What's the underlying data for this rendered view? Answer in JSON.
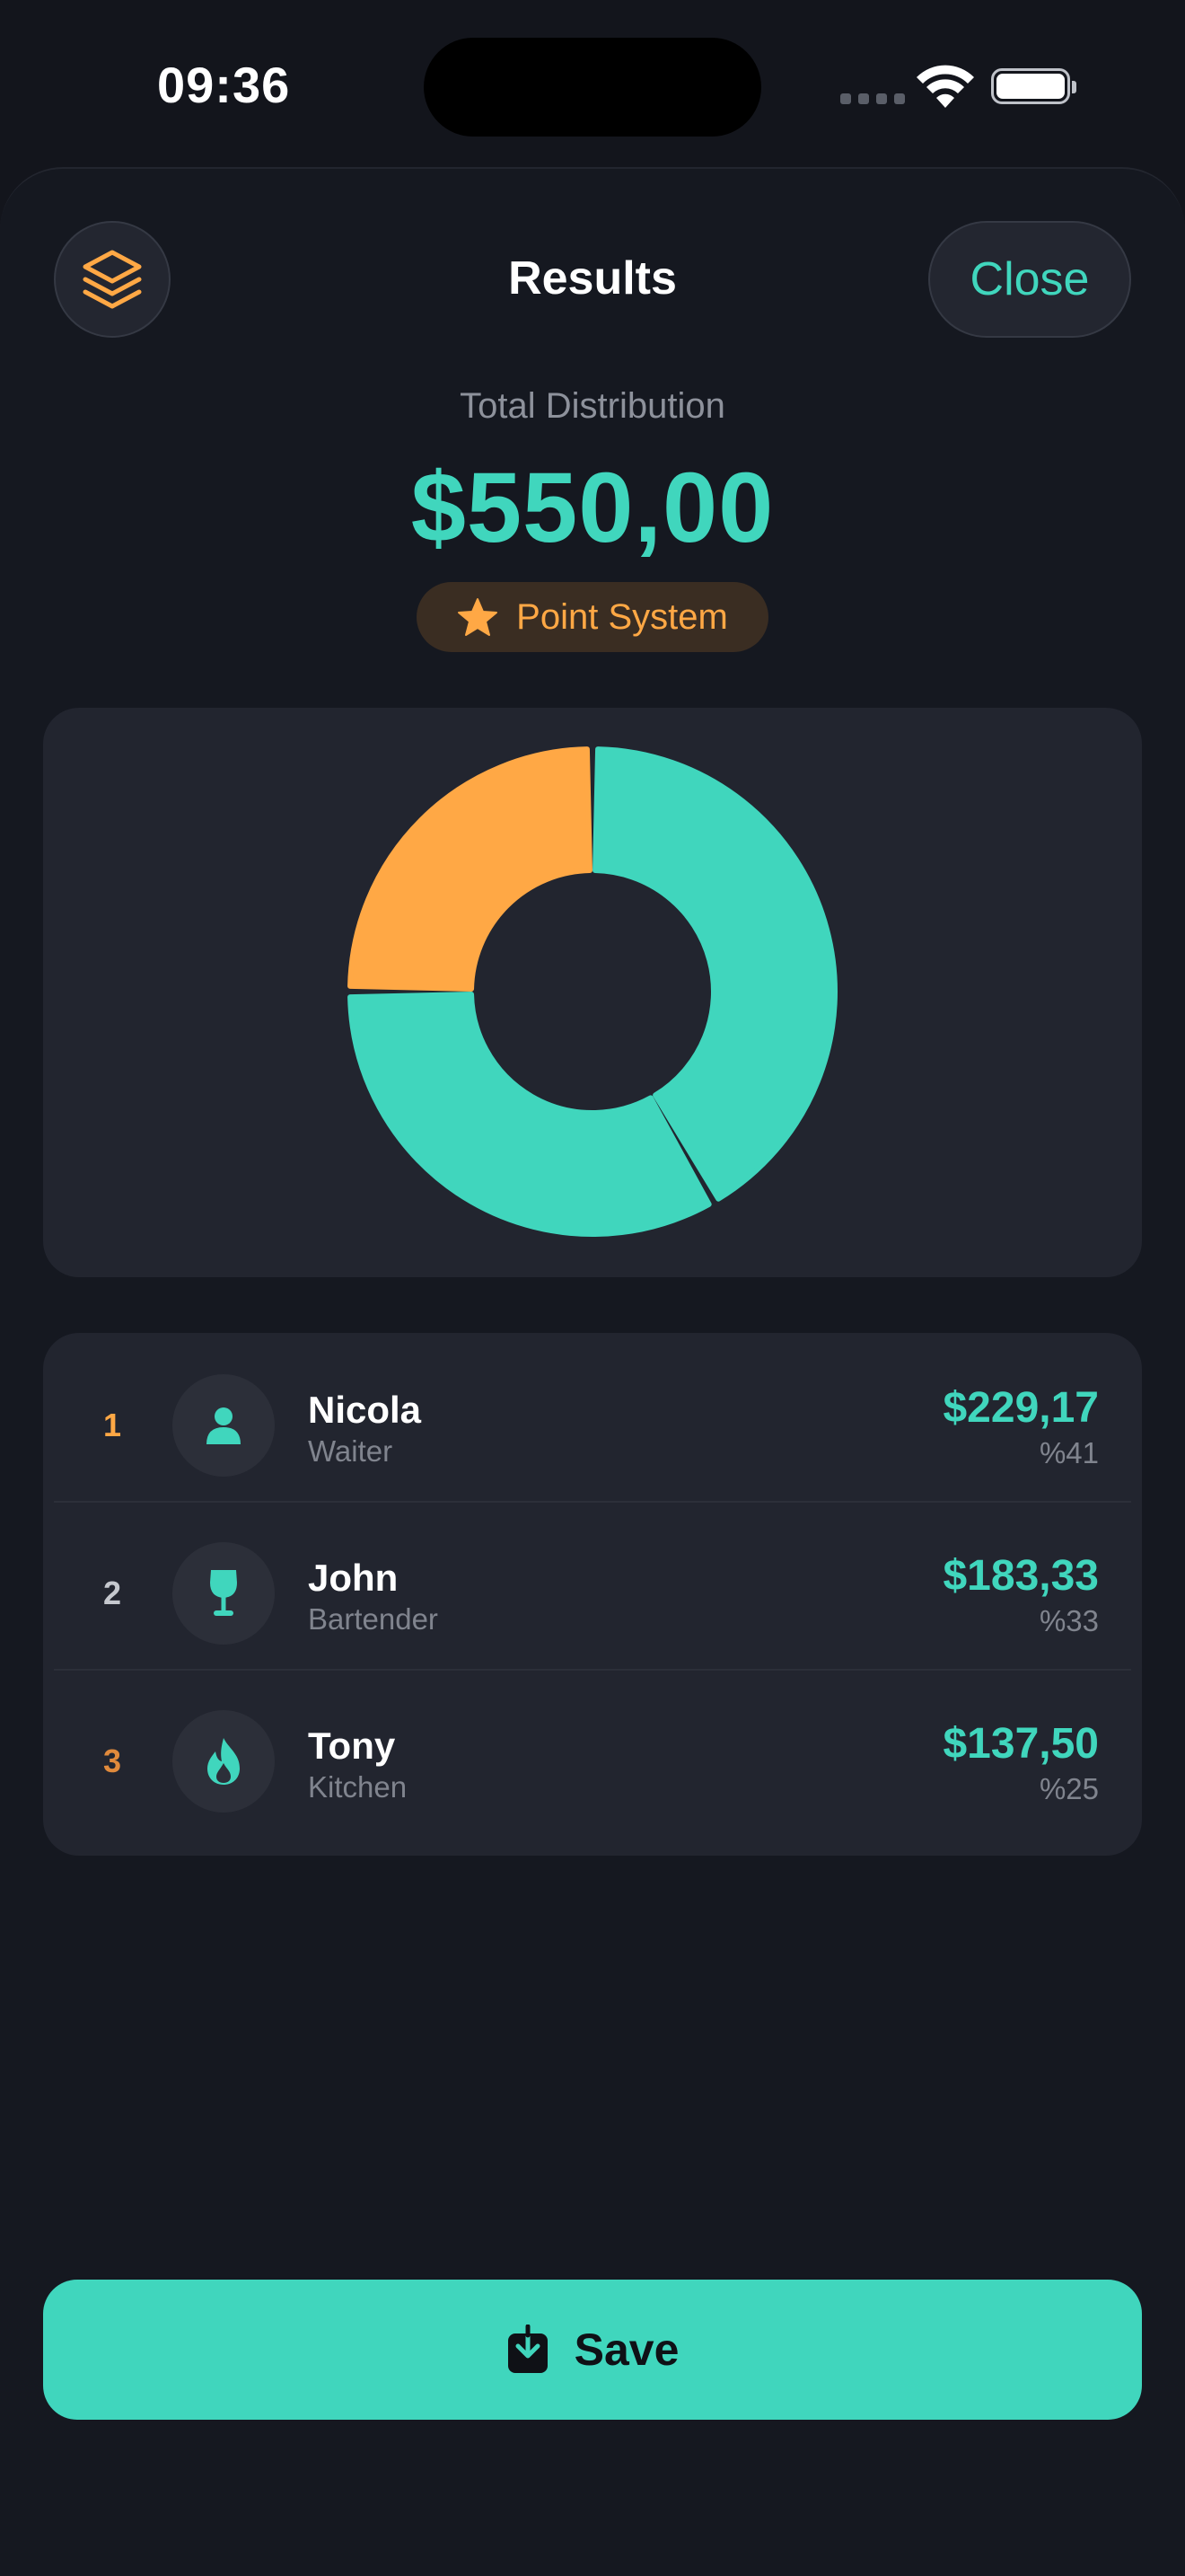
{
  "status_bar": {
    "time": "09:36"
  },
  "header": {
    "title": "Results",
    "close_label": "Close"
  },
  "summary": {
    "total_label": "Total Distribution",
    "total_amount": "$550,00",
    "system_badge": "Point System"
  },
  "colors": {
    "accent": "#40d6bd",
    "highlight": "#ffa845",
    "background": "#13151c",
    "card": "#22252f"
  },
  "chart_data": {
    "type": "pie",
    "style": "donut",
    "series": [
      {
        "label": "Nicola",
        "value": 229.17,
        "percent": 41,
        "color": "#40d6bd"
      },
      {
        "label": "John",
        "value": 183.33,
        "percent": 33,
        "color": "#40d6bd"
      },
      {
        "label": "Tony",
        "value": 137.5,
        "percent": 25,
        "color": "#ffa845"
      }
    ]
  },
  "results": [
    {
      "rank": "1",
      "rank_color": "#ffa845",
      "name": "Nicola",
      "role": "Waiter",
      "amount": "$229,17",
      "percent": "%41",
      "icon": "person-icon"
    },
    {
      "rank": "2",
      "rank_color": "#c5c8ce",
      "name": "John",
      "role": "Bartender",
      "amount": "$183,33",
      "percent": "%33",
      "icon": "wine-glass-icon"
    },
    {
      "rank": "3",
      "rank_color": "#e08a3c",
      "name": "Tony",
      "role": "Kitchen",
      "amount": "$137,50",
      "percent": "%25",
      "icon": "flame-icon"
    }
  ],
  "footer": {
    "save_label": "Save"
  }
}
